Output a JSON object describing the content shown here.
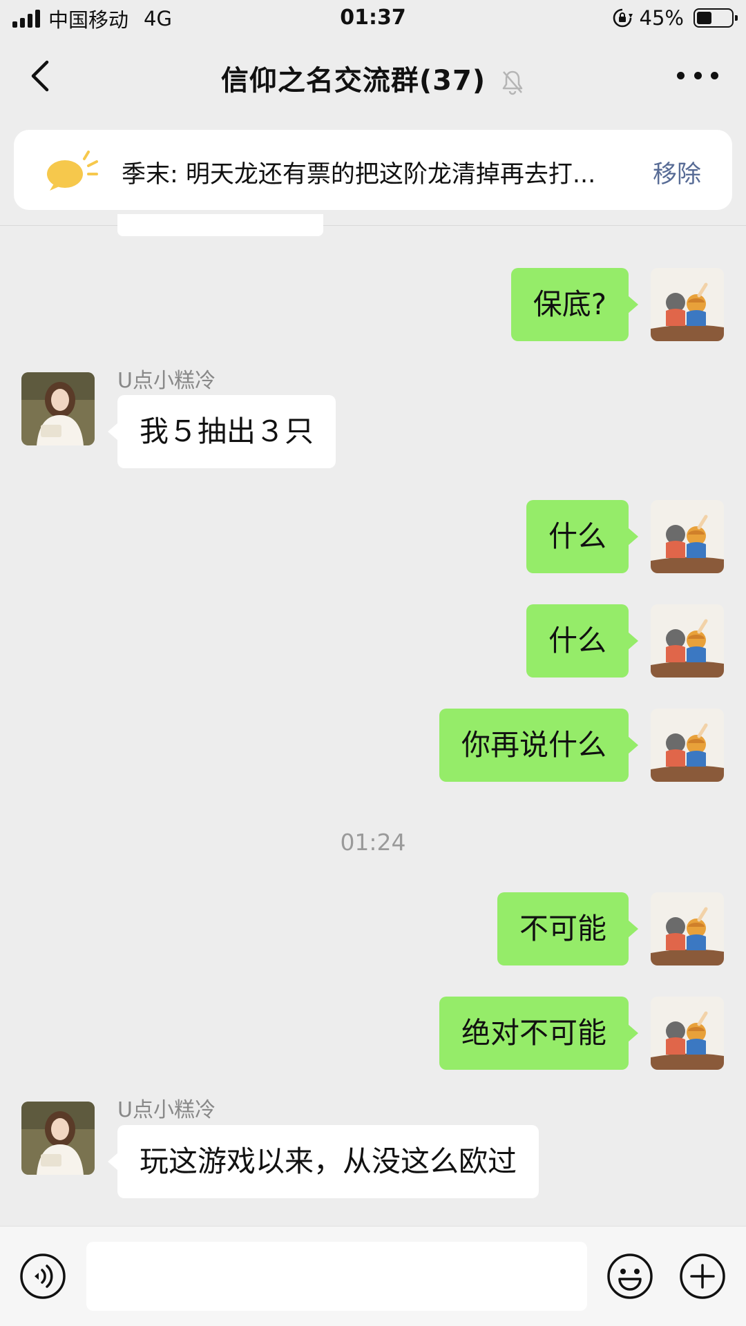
{
  "status_bar": {
    "carrier": "中国移动",
    "network": "4G",
    "time": "01:37",
    "battery_percent": "45%",
    "battery_level": 0.45,
    "icons": [
      "signal-icon",
      "rotation-lock-icon",
      "battery-icon"
    ]
  },
  "nav": {
    "title": "信仰之名交流群(37)",
    "icons": [
      "back-arrow-icon",
      "mute-bell-icon",
      "more-icon"
    ]
  },
  "pinned_notice": {
    "text": "季末: 明天龙还有票的把这阶龙清掉再去打...",
    "action": "移除",
    "icon": "speech-bubble-icon"
  },
  "messages": [
    {
      "side": "me",
      "text": "保底?"
    },
    {
      "side": "other",
      "sender": "U点小糕冷",
      "text": "我５抽出３只"
    },
    {
      "side": "me",
      "text": "什么"
    },
    {
      "side": "me",
      "text": "什么"
    },
    {
      "side": "me",
      "text": "你再说什么"
    },
    {
      "time": "01:24"
    },
    {
      "side": "me",
      "text": "不可能"
    },
    {
      "side": "me",
      "text": "绝对不可能"
    },
    {
      "side": "other",
      "sender": "U点小糕冷",
      "text": "玩这游戏以来，从没这么欧过"
    }
  ],
  "input_bar": {
    "value": "",
    "icons": [
      "voice-icon",
      "emoji-icon",
      "plus-icon"
    ]
  },
  "colors": {
    "background": "#ededed",
    "my_bubble": "#95ec69",
    "other_bubble": "#ffffff",
    "link": "#576b95"
  }
}
